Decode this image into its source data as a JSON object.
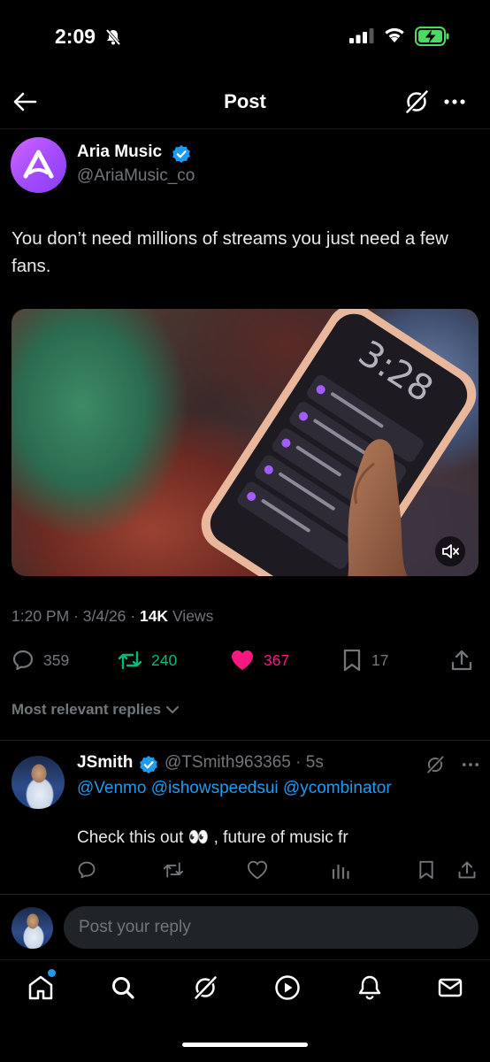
{
  "status_bar": {
    "time": "2:09"
  },
  "header": {
    "title": "Post"
  },
  "post": {
    "author_name": "Aria Music",
    "author_handle": "@AriaMusic_co",
    "text": "You don’t need millions of streams you just need a few fans.",
    "time": "1:20 PM",
    "date": "3/4/26",
    "views_count": "14K",
    "views_label": "Views",
    "replies": "359",
    "reposts": "240",
    "likes": "367",
    "bookmarks": "17"
  },
  "replies_sort_label": "Most relevant replies",
  "reply": {
    "name": "JSmith",
    "handle": "@TSmith963365",
    "time": "5s",
    "mentions": "@Venmo @ishowspeedsui @ycombinator",
    "text": "Check this out 👀 , future of music fr"
  },
  "composer": {
    "placeholder": "Post your reply"
  },
  "colors": {
    "background": "#000000",
    "accent": "#1d9bf0",
    "repost": "#00ba7c",
    "like": "#f91880",
    "muted": "#71767b"
  },
  "icons": [
    "back-arrow-icon",
    "grok-icon",
    "more-icon",
    "verified-icon",
    "mute-icon",
    "reply-icon",
    "retweet-icon",
    "heart-icon",
    "bookmark-icon",
    "share-icon",
    "chevron-down-icon",
    "views-icon",
    "home-icon",
    "search-icon",
    "video-icon",
    "bell-icon",
    "mail-icon"
  ]
}
